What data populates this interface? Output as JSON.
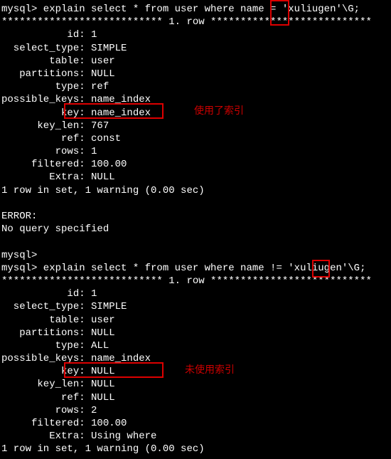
{
  "q1": {
    "prompt": "mysql> explain select * from user where name = 'xuliugen'\\G;",
    "sep": "*************************** 1. row ***************************",
    "rows": [
      "           id: 1",
      "  select_type: SIMPLE",
      "        table: user",
      "   partitions: NULL",
      "         type: ref",
      "possible_keys: name_index",
      "          key: name_index",
      "      key_len: 767",
      "          ref: const",
      "         rows: 1",
      "     filtered: 100.00",
      "        Extra: NULL"
    ],
    "result": "1 row in set, 1 warning (0.00 sec)"
  },
  "blank": " ",
  "err1": "ERROR:",
  "err2": "No query specified",
  "prompt_empty": "mysql>",
  "q2": {
    "prompt": "mysql> explain select * from user where name != 'xuliugen'\\G;",
    "sep": "*************************** 1. row ***************************",
    "rows": [
      "           id: 1",
      "  select_type: SIMPLE",
      "        table: user",
      "   partitions: NULL",
      "         type: ALL",
      "possible_keys: name_index",
      "          key: NULL",
      "      key_len: NULL",
      "          ref: NULL",
      "         rows: 2",
      "     filtered: 100.00",
      "        Extra: Using where"
    ],
    "result": "1 row in set, 1 warning (0.00 sec)"
  },
  "annotations": {
    "used_index": "使用了索引",
    "not_used_index": "未使用索引"
  }
}
